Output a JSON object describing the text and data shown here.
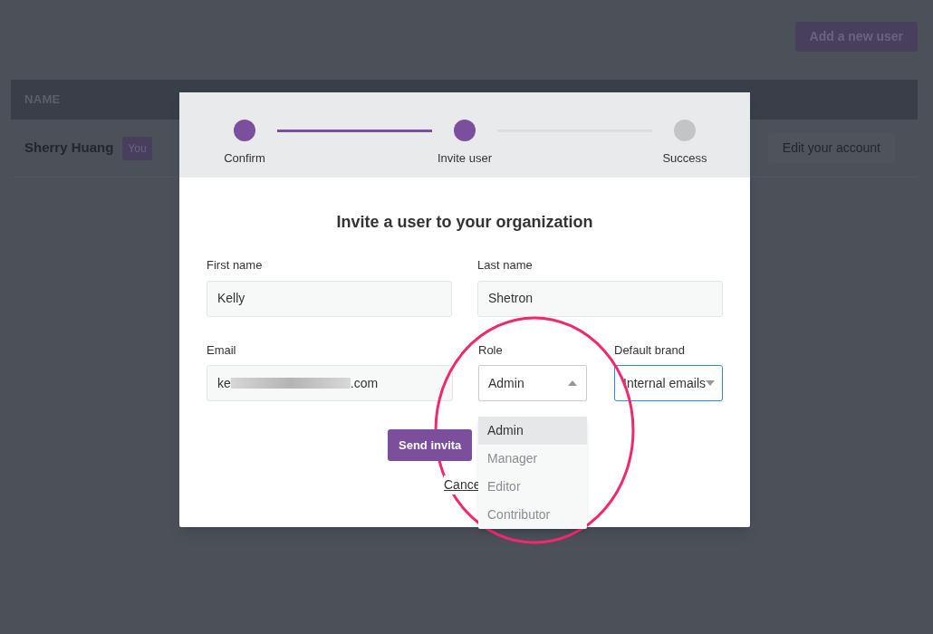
{
  "page": {
    "add_button": "Add a new user",
    "table": {
      "columns": [
        "NAME"
      ],
      "rows": [
        {
          "name": "Sherry Huang",
          "badge": "You",
          "action": "Edit your account"
        }
      ]
    }
  },
  "modal": {
    "steps": [
      {
        "label": "Confirm",
        "reached": true
      },
      {
        "label": "Invite user",
        "reached": true
      },
      {
        "label": "Success",
        "reached": false
      }
    ],
    "title": "Invite a user to your organization",
    "first_name": {
      "label": "First name",
      "value": "Kelly"
    },
    "last_name": {
      "label": "Last name",
      "value": "Shetron"
    },
    "email": {
      "label": "Email",
      "value_start": "ke",
      "value_end": ".com",
      "redacted": true
    },
    "role": {
      "label": "Role",
      "value": "Admin",
      "expanded": true,
      "options": [
        {
          "label": "Admin",
          "selected": true
        },
        {
          "label": "Manager",
          "selected": false
        },
        {
          "label": "Editor",
          "selected": false
        },
        {
          "label": "Contributor",
          "selected": false
        }
      ]
    },
    "brand": {
      "label": "Default brand",
      "value": "Internal emails",
      "focused": true
    },
    "submit": "Send invita",
    "cancel": "Cance"
  },
  "annotation": {
    "shown": true
  }
}
